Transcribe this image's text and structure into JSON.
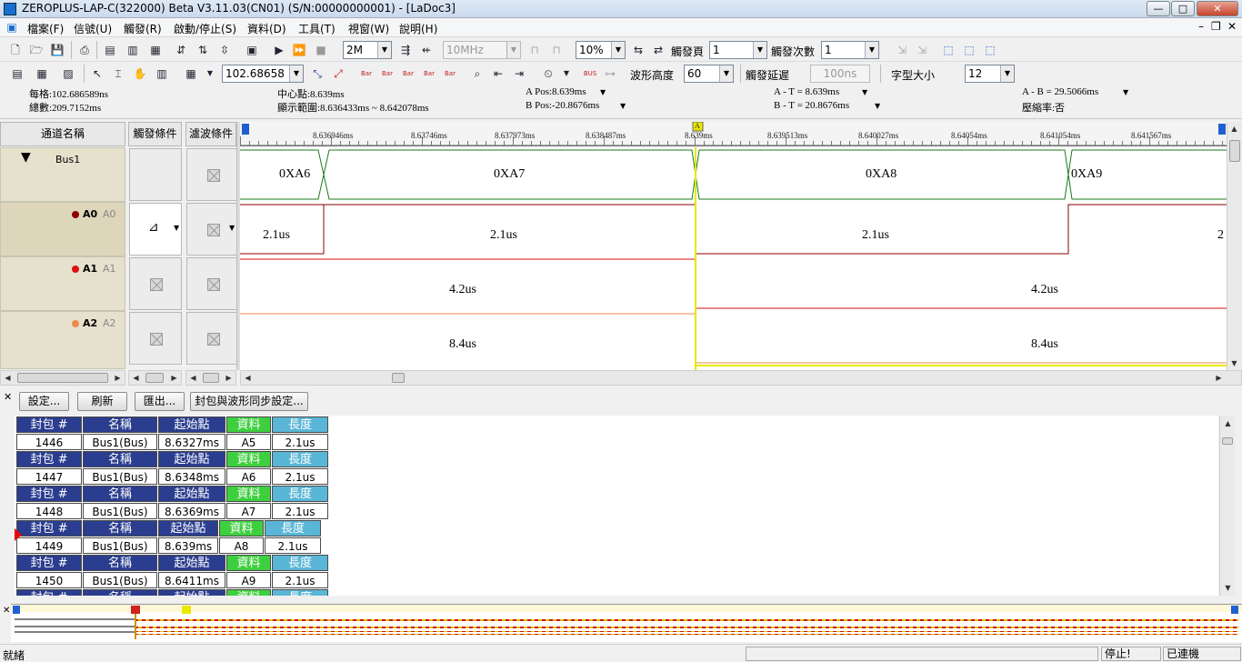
{
  "window": {
    "title": "ZEROPLUS-LAP-C(322000) Beta V3.11.03(CN01) (S/N:00000000001) - [LaDoc3]",
    "buttons": {
      "minimize": "—",
      "maximize": "□",
      "close": "✕"
    }
  },
  "menu": [
    "檔案(F)",
    "信號(U)",
    "觸發(R)",
    "啟動/停止(S)",
    "資料(D)",
    "工具(T)",
    "視窗(W)",
    "說明(H)"
  ],
  "mdi_buttons": {
    "minimize": "–",
    "restore": "❐",
    "close": "✕"
  },
  "toolbar1": {
    "sample_depth": "2M",
    "sample_rate": "10MHz",
    "trigger_position": "10%",
    "trigger_page_label": "觸發頁",
    "trigger_page_value": "1",
    "trigger_count_label": "觸發次數",
    "trigger_count_value": "1"
  },
  "toolbar2": {
    "zoom_value": "102.68658",
    "bus_icon_text": "Bar",
    "waveform_height_label": "波形高度",
    "waveform_height_value": "60",
    "trigger_delay_label": "觸發延遲",
    "trigger_delay_value": "100ns",
    "font_size_label": "字型大小",
    "font_size_value": "12"
  },
  "info": {
    "per_div": "每格:102.686589ns",
    "total": "總數:209.7152ms",
    "center": "中心點:8.639ms",
    "range": "顯示範圍:8.636433ms ~ 8.642078ms",
    "a_pos": "A Pos:8.639ms",
    "b_pos": "B Pos:-20.8676ms",
    "a_t": "A - T = 8.639ms",
    "b_t": "B - T = 20.8676ms",
    "a_b": "A - B = 29.5066ms",
    "compression": "壓縮率:否"
  },
  "channels": {
    "header_name": "通道名稱",
    "header_trigger": "觸發條件",
    "header_filter": "濾波條件",
    "bus_name": "Bus1",
    "rows": [
      {
        "name": "A0",
        "alias": "A0",
        "color": "#8b0000"
      },
      {
        "name": "A1",
        "alias": "A1",
        "color": "#dd1111"
      },
      {
        "name": "A2",
        "alias": "A2",
        "color": "#f08a4b"
      }
    ]
  },
  "ruler": {
    "ticks": [
      "8.636946ms",
      "8.63746ms",
      "8.637973ms",
      "8.638487ms",
      "8.639ms",
      "8.639513ms",
      "8.640027ms",
      "8.64054ms",
      "8.641054ms",
      "8.641567ms"
    ],
    "cursor_a": "A",
    "cursor_t": "T",
    "cursor_b": "B"
  },
  "waveform": {
    "bus_values": [
      "0XA6",
      "0XA7",
      "0XA8",
      "0XA9"
    ],
    "a0_labels": [
      "2.1us",
      "2.1us",
      "2.1us",
      "2"
    ],
    "a1_labels": [
      "4.2us",
      "4.2us"
    ],
    "a2_labels": [
      "8.4us",
      "8.4us"
    ]
  },
  "lower_toolbar": {
    "settings": "設定...",
    "refresh": "刷新",
    "export": "匯出...",
    "sync": "封包與波形同步設定..."
  },
  "packets": {
    "headers": {
      "packet": "封包 #",
      "name": "名稱",
      "start": "起始點",
      "data": "資料",
      "length": "長度"
    },
    "rows": [
      {
        "id": "1446",
        "name": "Bus1(Bus)",
        "start": "8.6327ms",
        "data": "A5",
        "length": "2.1us"
      },
      {
        "id": "1447",
        "name": "Bus1(Bus)",
        "start": "8.6348ms",
        "data": "A6",
        "length": "2.1us"
      },
      {
        "id": "1448",
        "name": "Bus1(Bus)",
        "start": "8.6369ms",
        "data": "A7",
        "length": "2.1us"
      },
      {
        "id": "1449",
        "name": "Bus1(Bus)",
        "start": "8.639ms",
        "data": "A8",
        "length": "2.1us"
      },
      {
        "id": "1450",
        "name": "Bus1(Bus)",
        "start": "8.6411ms",
        "data": "A9",
        "length": "2.1us"
      }
    ]
  },
  "status": {
    "left": "就緒",
    "state": "停止!",
    "connection": "已連機"
  },
  "colors": {
    "bus": "#1b7a1b",
    "cursor_a": "#e8e800",
    "bus_header": "#2b3d8f",
    "data_header": "#3ecf3e",
    "length_header": "#5ab6d6"
  }
}
